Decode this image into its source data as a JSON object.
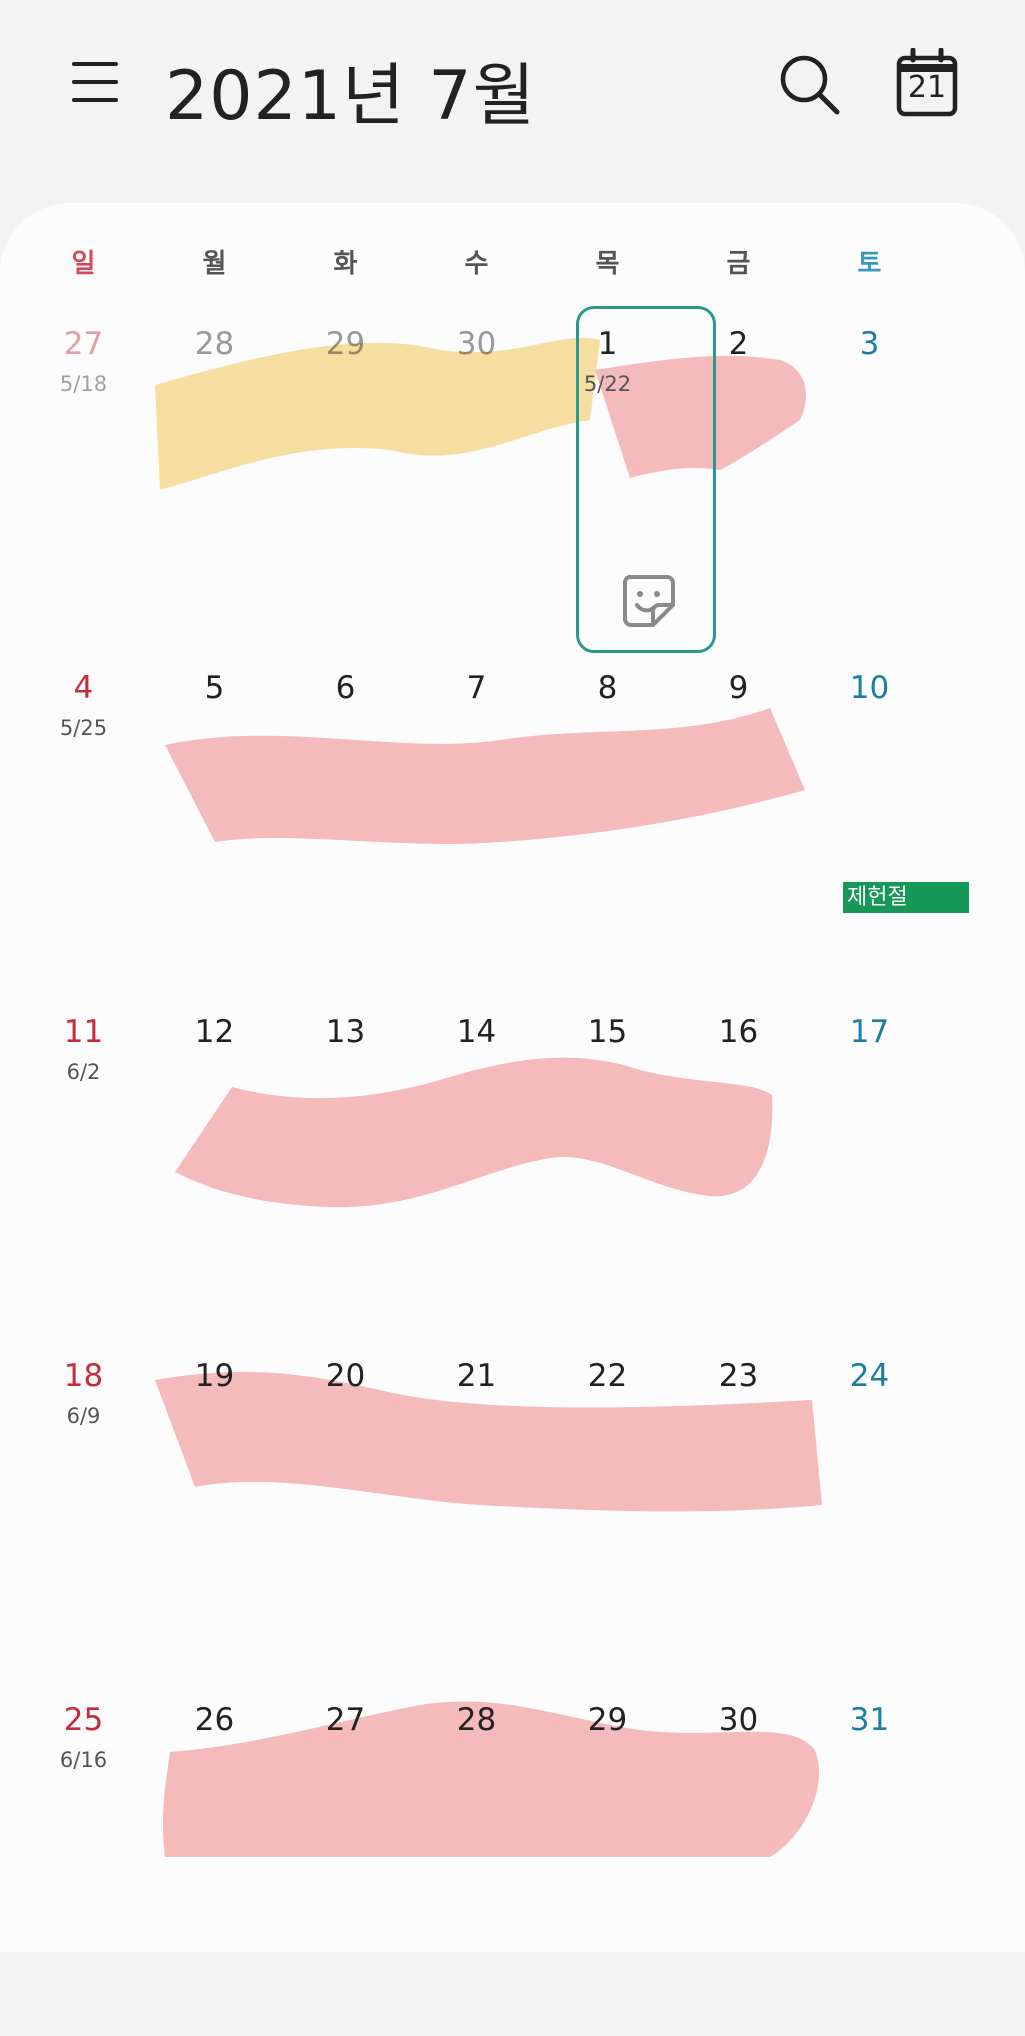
{
  "header": {
    "title": "2021년 7월",
    "today_date": "21",
    "icons": {
      "menu": "menu-icon",
      "search": "search-icon",
      "today": "calendar-today-icon"
    }
  },
  "weekdays": [
    "일",
    "월",
    "화",
    "수",
    "목",
    "금",
    "토"
  ],
  "weeks": [
    {
      "days": [
        "27",
        "28",
        "29",
        "30",
        "1",
        "2",
        "3"
      ],
      "lunar": [
        "5/18",
        "",
        "",
        "",
        "5/22",
        "",
        ""
      ]
    },
    {
      "days": [
        "4",
        "5",
        "6",
        "7",
        "8",
        "9",
        "10"
      ],
      "lunar": [
        "5/25",
        "",
        "",
        "",
        "",
        "",
        ""
      ]
    },
    {
      "days": [
        "11",
        "12",
        "13",
        "14",
        "15",
        "16",
        "17"
      ],
      "lunar": [
        "6/2",
        "",
        "",
        "",
        "",
        "",
        ""
      ]
    },
    {
      "days": [
        "18",
        "19",
        "20",
        "21",
        "22",
        "23",
        "24"
      ],
      "lunar": [
        "6/9",
        "",
        "",
        "",
        "",
        "",
        ""
      ]
    },
    {
      "days": [
        "25",
        "26",
        "27",
        "28",
        "29",
        "30",
        "31"
      ],
      "lunar": [
        "6/16",
        "",
        "",
        "",
        "",
        "",
        ""
      ]
    }
  ],
  "selected_day": "1",
  "events": {
    "holiday_label": "제헌절"
  },
  "colors": {
    "sunday": "#c62d3c",
    "saturday": "#1a7fa0",
    "selected_border": "#2a9a8c",
    "holiday_bg": "#169957",
    "highlight_pink": "#f4b3b5",
    "highlight_yellow": "#f5d88f"
  }
}
